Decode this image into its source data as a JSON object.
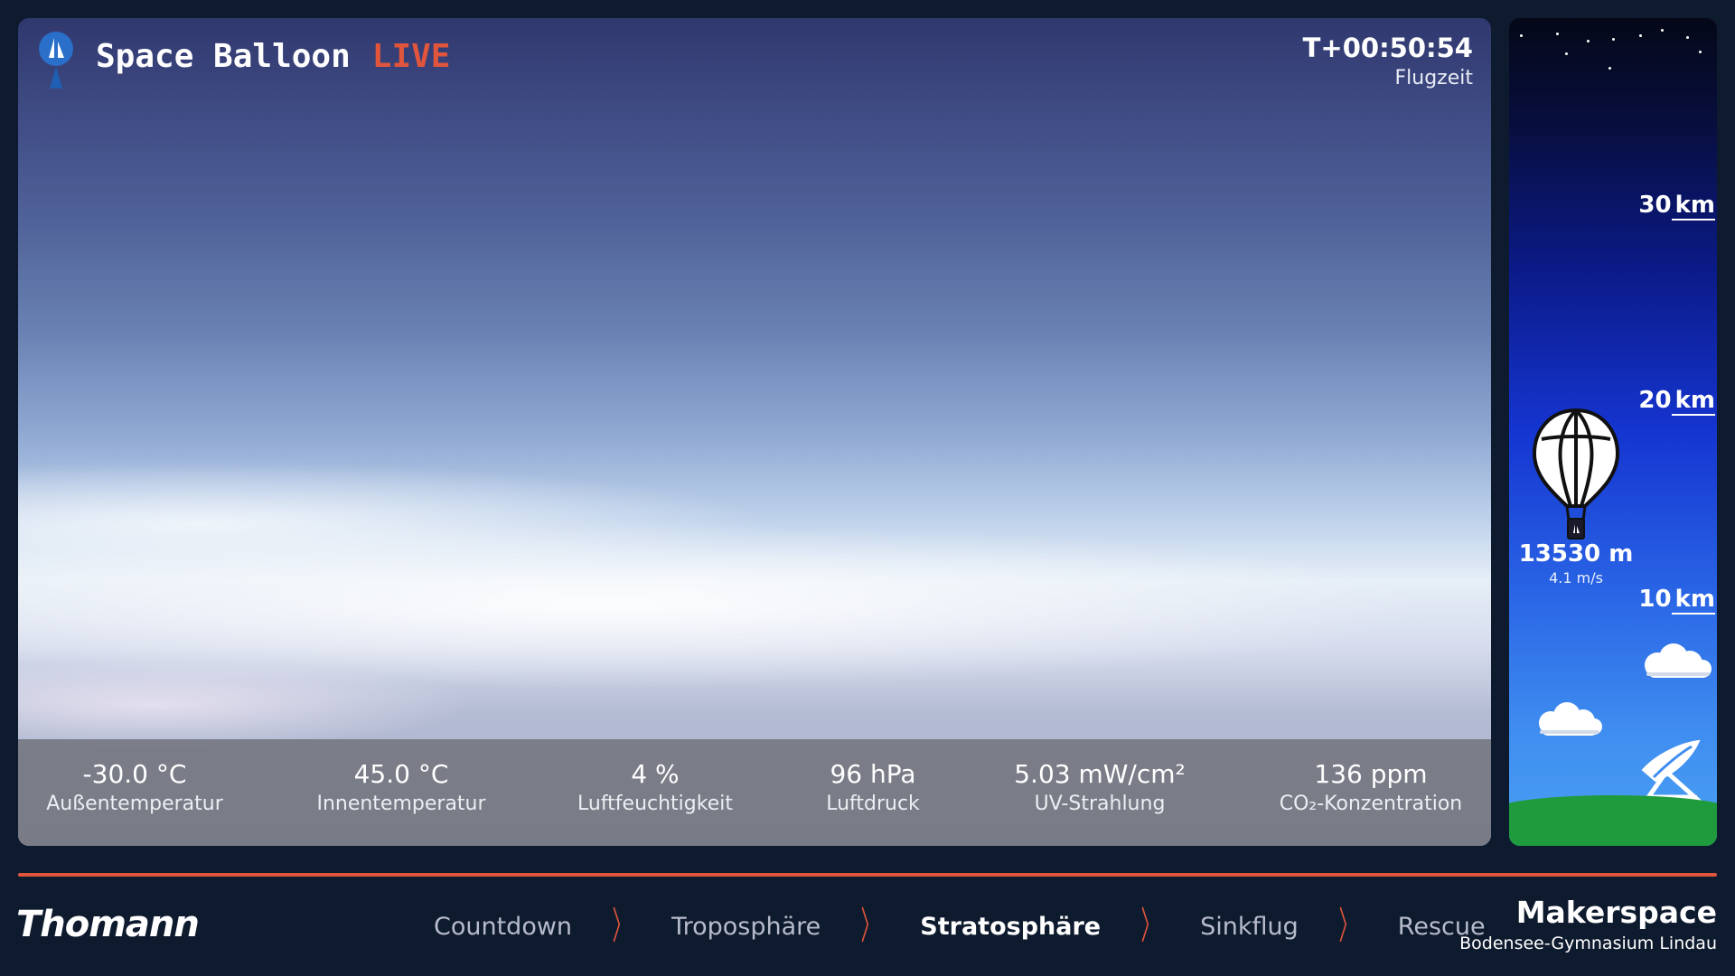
{
  "header": {
    "title": "Space Balloon",
    "live": "LIVE"
  },
  "clock": {
    "time": "T+00:50:54",
    "label": "Flugzeit"
  },
  "stats": [
    {
      "value": "-30.0 °C",
      "label": "Außentemperatur"
    },
    {
      "value": "45.0 °C",
      "label": "Innentemperatur"
    },
    {
      "value": "4 %",
      "label": "Luftfeuchtigkeit"
    },
    {
      "value": "96 hPa",
      "label": "Luftdruck"
    },
    {
      "value": "5.03 mW/cm²",
      "label": "UV-Strahlung"
    },
    {
      "value": "136 ppm",
      "label": "CO₂-Konzentration"
    }
  ],
  "altitude": {
    "scale": [
      {
        "value": "30",
        "unit": "km"
      },
      {
        "value": "20",
        "unit": "km"
      },
      {
        "value": "10",
        "unit": "km"
      }
    ],
    "current": "13530 m",
    "speed": "4.1 m/s"
  },
  "phases": [
    "Countdown",
    "Troposphäre",
    "Stratosphäre",
    "Sinkflug",
    "Rescue"
  ],
  "active_phase": "Stratosphäre",
  "brand": "Thomann",
  "org": {
    "name": "Makerspace",
    "sub": "Bodensee-Gymnasium Lindau"
  },
  "colors": {
    "accent": "#e0553c",
    "background": "#0e1a2e",
    "ground": "#1f9a3c"
  }
}
